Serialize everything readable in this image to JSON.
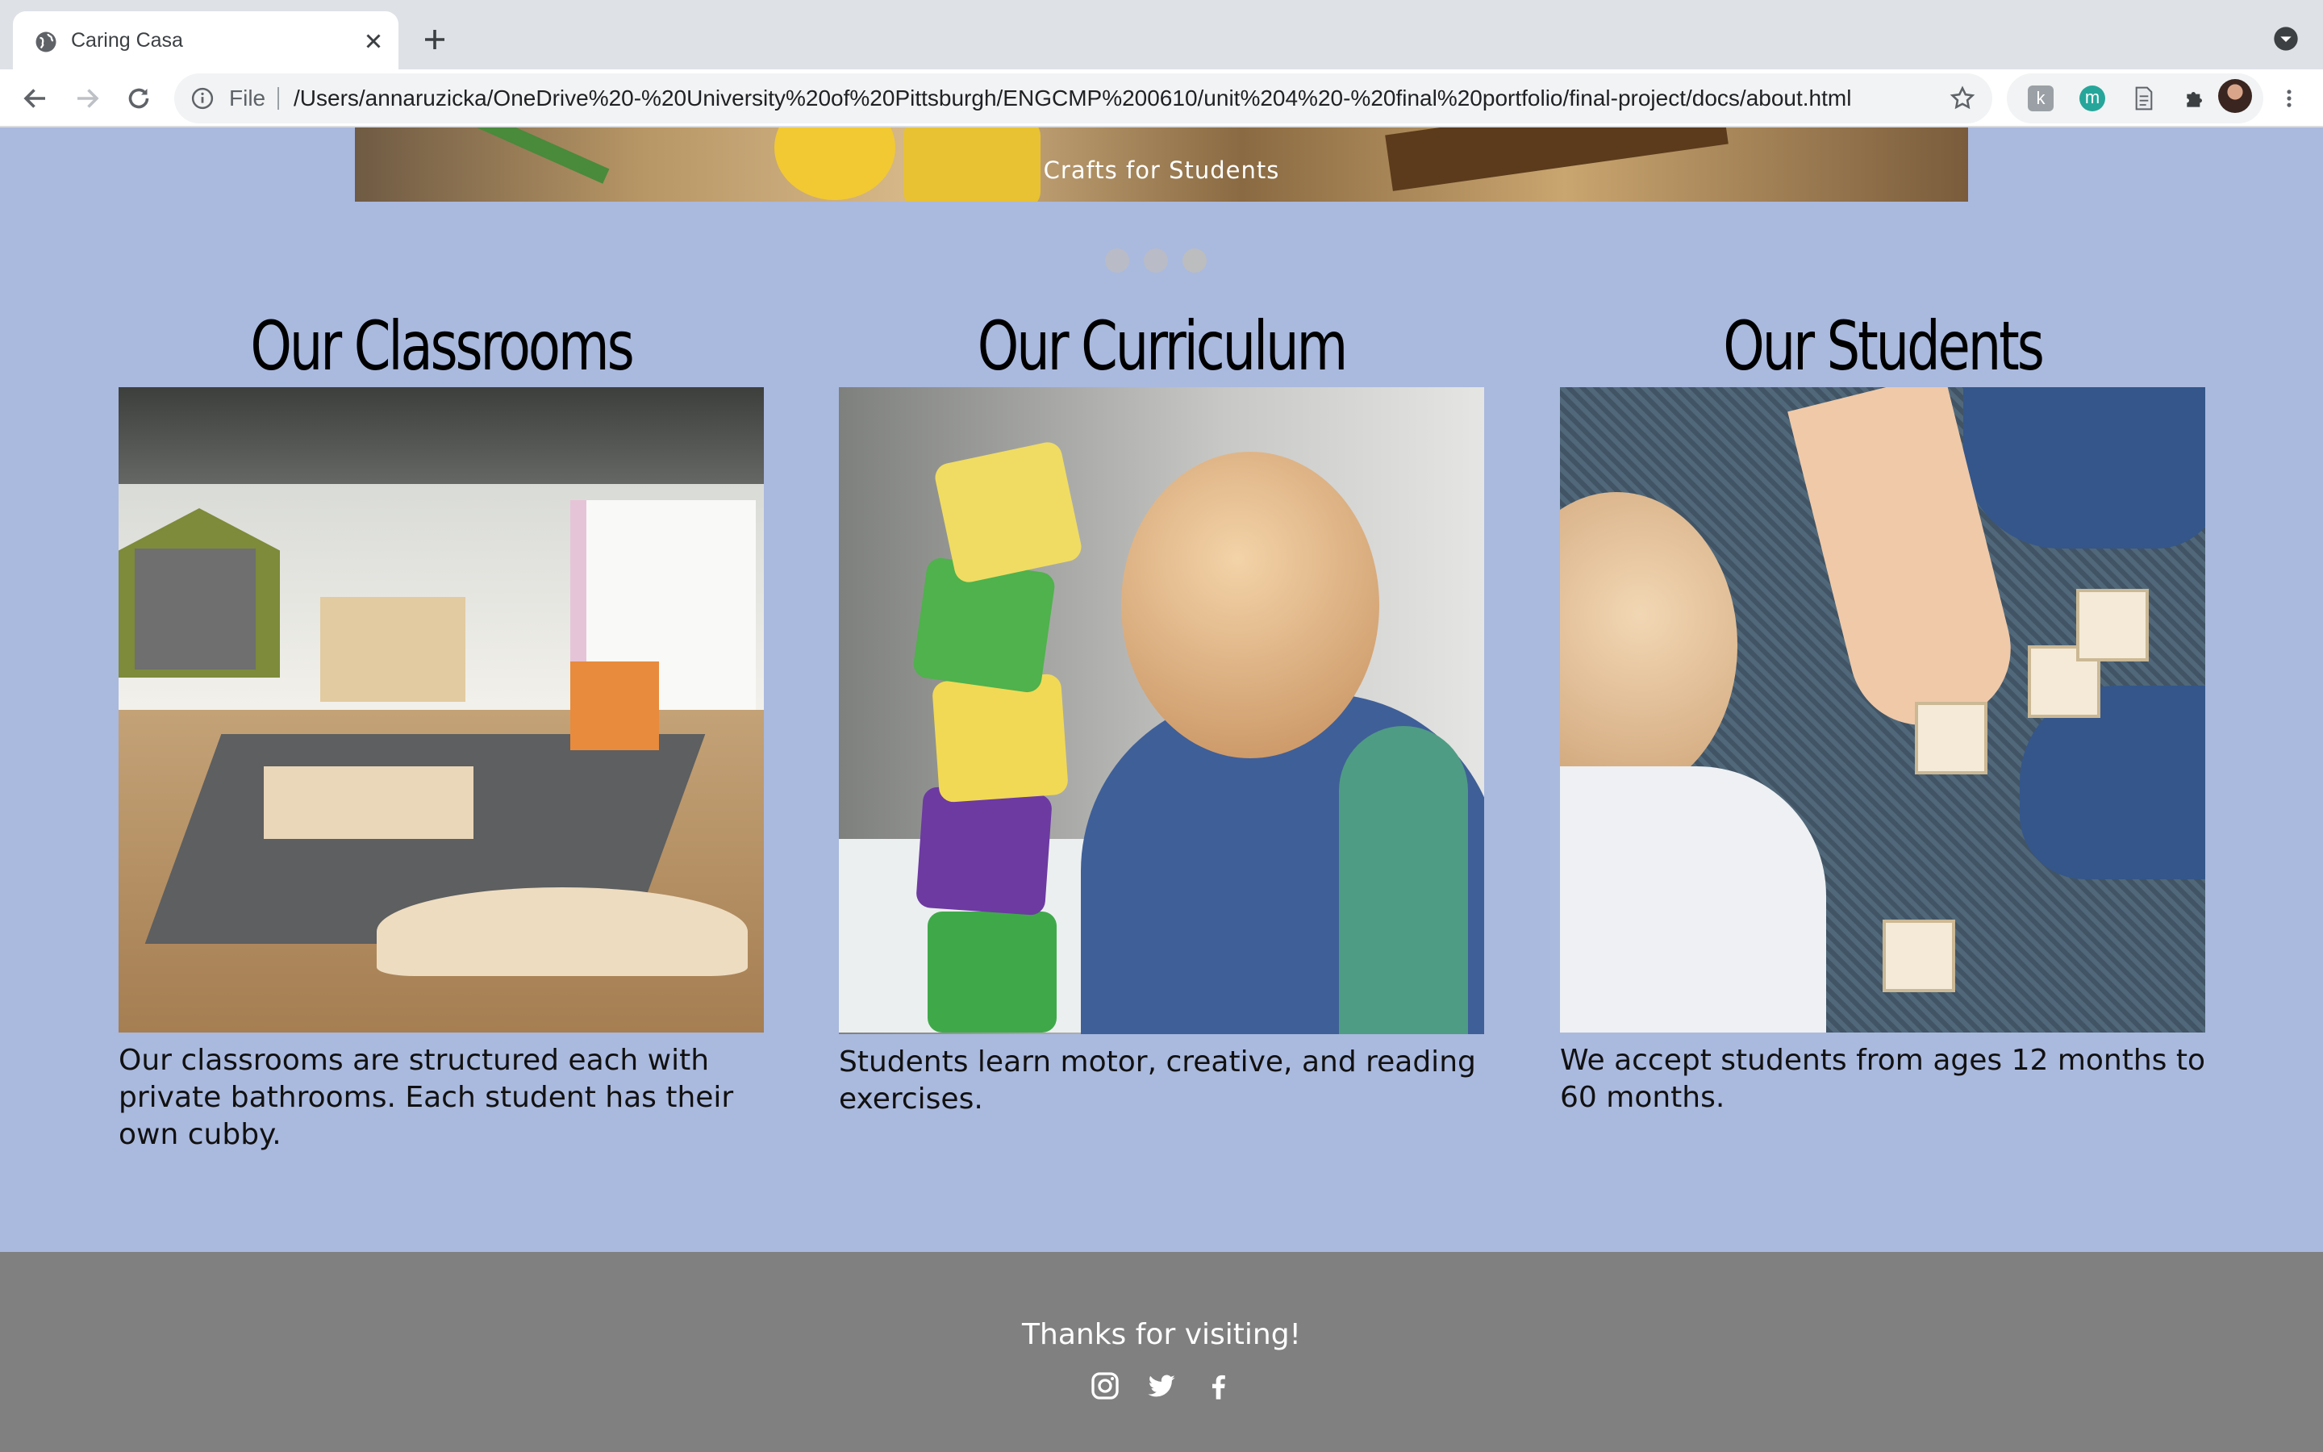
{
  "browser": {
    "tab_title": "Caring Casa",
    "omnibox_scheme": "File",
    "url": "/Users/annaruzicka/OneDrive%20-%20University%20of%20Pittsburgh/ENGCMP%200610/unit%204%20-%20final%20portfolio/final-project/docs/about.html",
    "extensions": [
      "k-extension-icon",
      "m-extension-icon",
      "document-extension-icon",
      "puzzle-icon"
    ]
  },
  "carousel": {
    "caption": "Crafts for Students",
    "indicator_count": 3
  },
  "columns": [
    {
      "title": "Our Classrooms",
      "text": "Our classrooms are structured each with private bathrooms. Each student has their own cubby."
    },
    {
      "title": "Our Curriculum",
      "text": "Students learn motor, creative, and reading exercises."
    },
    {
      "title": "Our Students",
      "text": "We accept students from ages 12 months to 60 months."
    }
  ],
  "footer": {
    "text": "Thanks for visiting!",
    "social": [
      "instagram-icon",
      "twitter-icon",
      "facebook-icon"
    ]
  },
  "colors": {
    "page_background": "#aab9de",
    "footer_background": "#808080"
  }
}
